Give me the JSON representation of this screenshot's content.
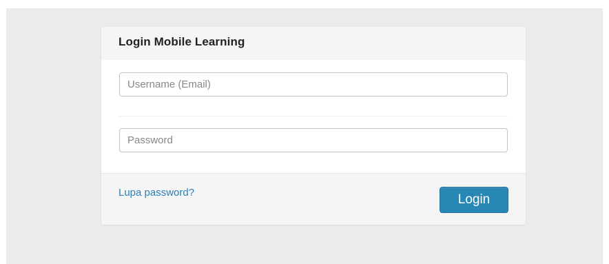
{
  "login_card": {
    "title": "Login Mobile Learning",
    "username_field": {
      "placeholder": "Username (Email)",
      "value": ""
    },
    "password_field": {
      "placeholder": "Password",
      "value": ""
    },
    "forgot_password_label": "Lupa password?",
    "login_button_label": "Login"
  },
  "colors": {
    "page_background": "#ebebeb",
    "card_header_background": "#f5f5f5",
    "link": "#2a7fb5",
    "primary_button": "#2987b6"
  }
}
